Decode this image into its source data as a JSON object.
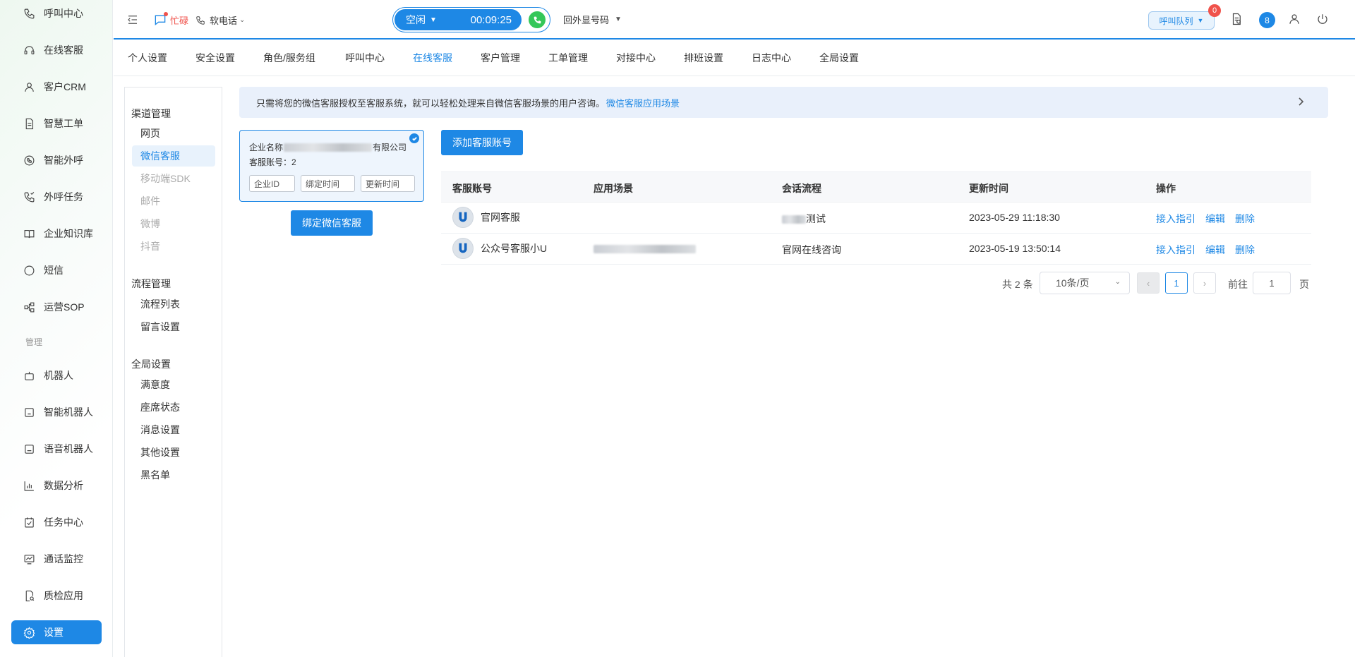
{
  "sidebar": {
    "items": [
      {
        "label": "呼叫中心",
        "icon": "phone-icon"
      },
      {
        "label": "在线客服",
        "icon": "headset-icon"
      },
      {
        "label": "客户CRM",
        "icon": "user-icon"
      },
      {
        "label": "智慧工单",
        "icon": "document-icon"
      },
      {
        "label": "智能外呼",
        "icon": "phone-circle-icon"
      },
      {
        "label": "外呼任务",
        "icon": "phone-task-icon"
      },
      {
        "label": "企业知识库",
        "icon": "book-icon"
      },
      {
        "label": "短信",
        "icon": "sms-icon"
      },
      {
        "label": "运营SOP",
        "icon": "flow-icon"
      },
      {
        "label": "机器人",
        "icon": "robot-icon"
      },
      {
        "label": "智能机器人",
        "icon": "smart-robot-icon"
      },
      {
        "label": "语音机器人",
        "icon": "voice-robot-icon"
      },
      {
        "label": "数据分析",
        "icon": "chart-icon"
      },
      {
        "label": "任务中心",
        "icon": "task-icon"
      },
      {
        "label": "通话监控",
        "icon": "monitor-icon"
      },
      {
        "label": "质检应用",
        "icon": "inspect-icon"
      },
      {
        "label": "设置",
        "icon": "gear-icon"
      }
    ],
    "section_label": "管理"
  },
  "topbar": {
    "busy_label": "忙碌",
    "soft_phone_label": "软电话",
    "status_label": "空闲",
    "timer": "00:09:25",
    "outbound_label": "回外显号码",
    "queue_label": "呼叫队列",
    "queue_badge": "0",
    "user_number": "8"
  },
  "tabs": [
    "个人设置",
    "安全设置",
    "角色/服务组",
    "呼叫中心",
    "在线客服",
    "客户管理",
    "工单管理",
    "对接中心",
    "排班设置",
    "日志中心",
    "全局设置"
  ],
  "active_tab": "在线客服",
  "subnav": {
    "groups": [
      {
        "title": "渠道管理",
        "items": [
          "网页",
          "微信客服",
          "移动端SDK",
          "邮件",
          "微博",
          "抖音"
        ]
      },
      {
        "title": "流程管理",
        "items": [
          "流程列表",
          "留言设置"
        ]
      },
      {
        "title": "全局设置",
        "items": [
          "满意度",
          "座席状态",
          "消息设置",
          "其他设置",
          "黑名单"
        ]
      }
    ]
  },
  "banner": {
    "text": "只需将您的微信客服授权至客服系统，就可以轻松处理来自微信客服场景的用户咨询。",
    "link": "微信客服应用场景"
  },
  "enterprise_card": {
    "name_label": "企业名称",
    "name_suffix": "有限公司",
    "account_count_label": "客服账号：2",
    "pills": [
      "企业ID",
      "绑定时间",
      "更新时间"
    ]
  },
  "bind_button": "绑定微信客服",
  "add_button": "添加客服账号",
  "table": {
    "headers": [
      "客服账号",
      "应用场景",
      "会话流程",
      "更新时间",
      "操作"
    ],
    "rows": [
      {
        "account": "官网客服",
        "scene": "",
        "flow": "测试",
        "updated": "2023-05-29 11:18:30",
        "ops": [
          "接入指引",
          "编辑",
          "删除"
        ]
      },
      {
        "account": "公众号客服小U",
        "scene": "",
        "flow": "官网在线咨询",
        "updated": "2023-05-19 13:50:14",
        "ops": [
          "接入指引",
          "编辑",
          "删除"
        ]
      }
    ]
  },
  "pagination": {
    "total": "共 2 条",
    "page_size": "10条/页",
    "current_page": "1",
    "goto_label": "前往",
    "goto_value": "1",
    "page_suffix": "页"
  },
  "colors": {
    "primary": "#1e88e5",
    "danger": "#f0524b",
    "call": "#34c759"
  }
}
